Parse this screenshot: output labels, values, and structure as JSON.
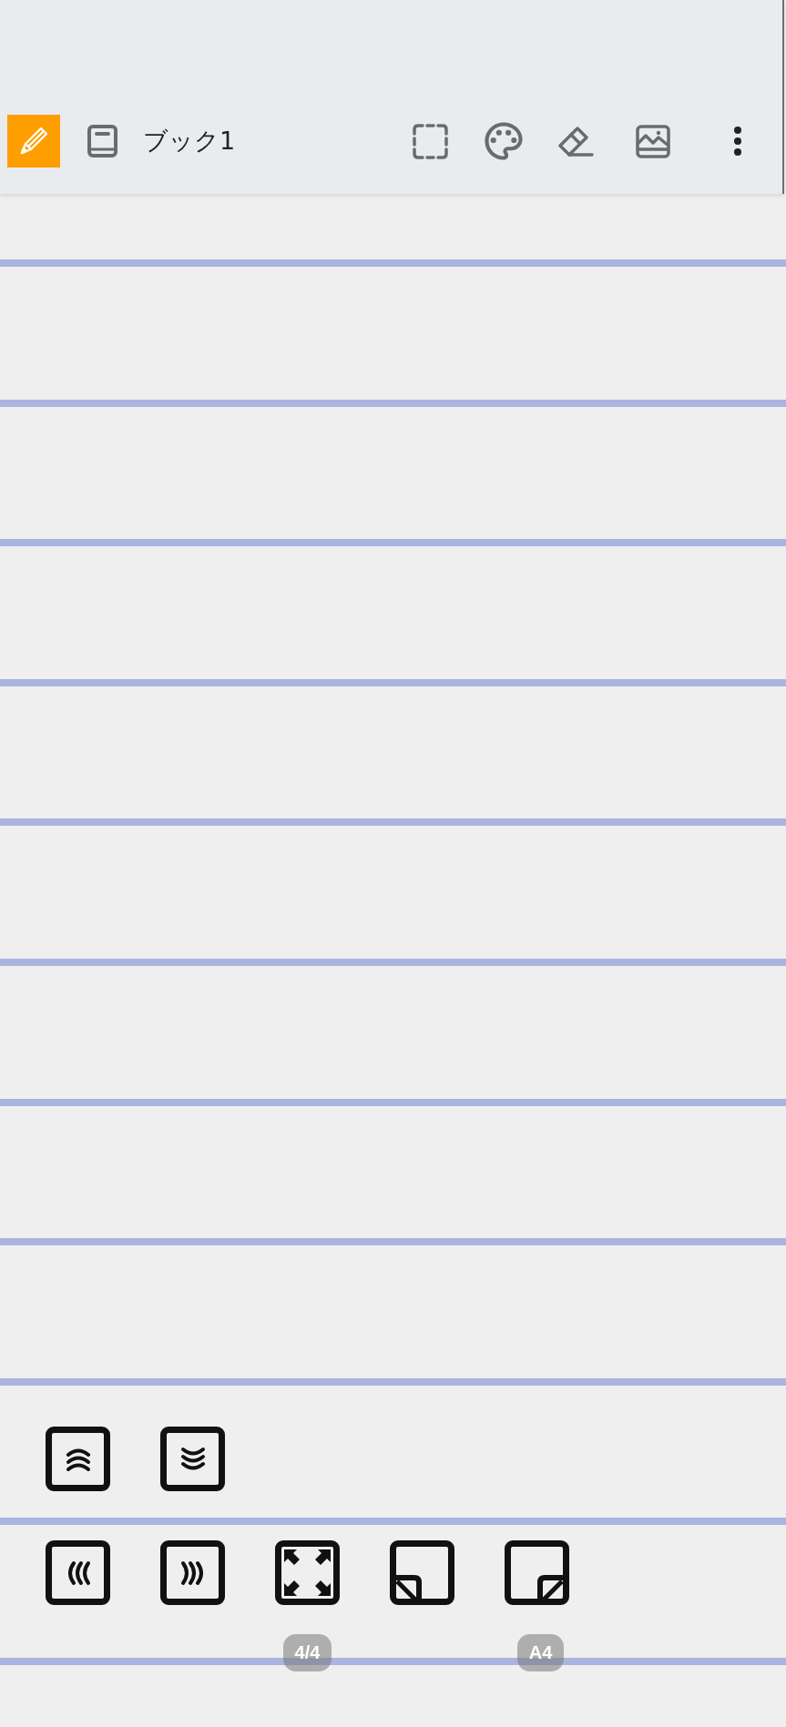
{
  "toolbar": {
    "pen": {
      "on": true
    },
    "notebook_title": "ブック1",
    "actions": [
      {
        "kind": "select"
      },
      {
        "kind": "palette"
      },
      {
        "kind": "eraser"
      },
      {
        "kind": "image"
      },
      {
        "kind": "more"
      }
    ]
  },
  "page_controls": {
    "rows": [
      {
        "buttons": [
          {
            "kind": "scroll_up"
          },
          {
            "kind": "scroll_down"
          }
        ]
      },
      {
        "buttons": [
          {
            "kind": "prev"
          },
          {
            "kind": "next"
          },
          {
            "kind": "fullscreen"
          },
          {
            "kind": "corner_left"
          },
          {
            "kind": "corner_right"
          }
        ]
      }
    ]
  },
  "status": {
    "page": "4/4",
    "paper_size": "A4"
  }
}
